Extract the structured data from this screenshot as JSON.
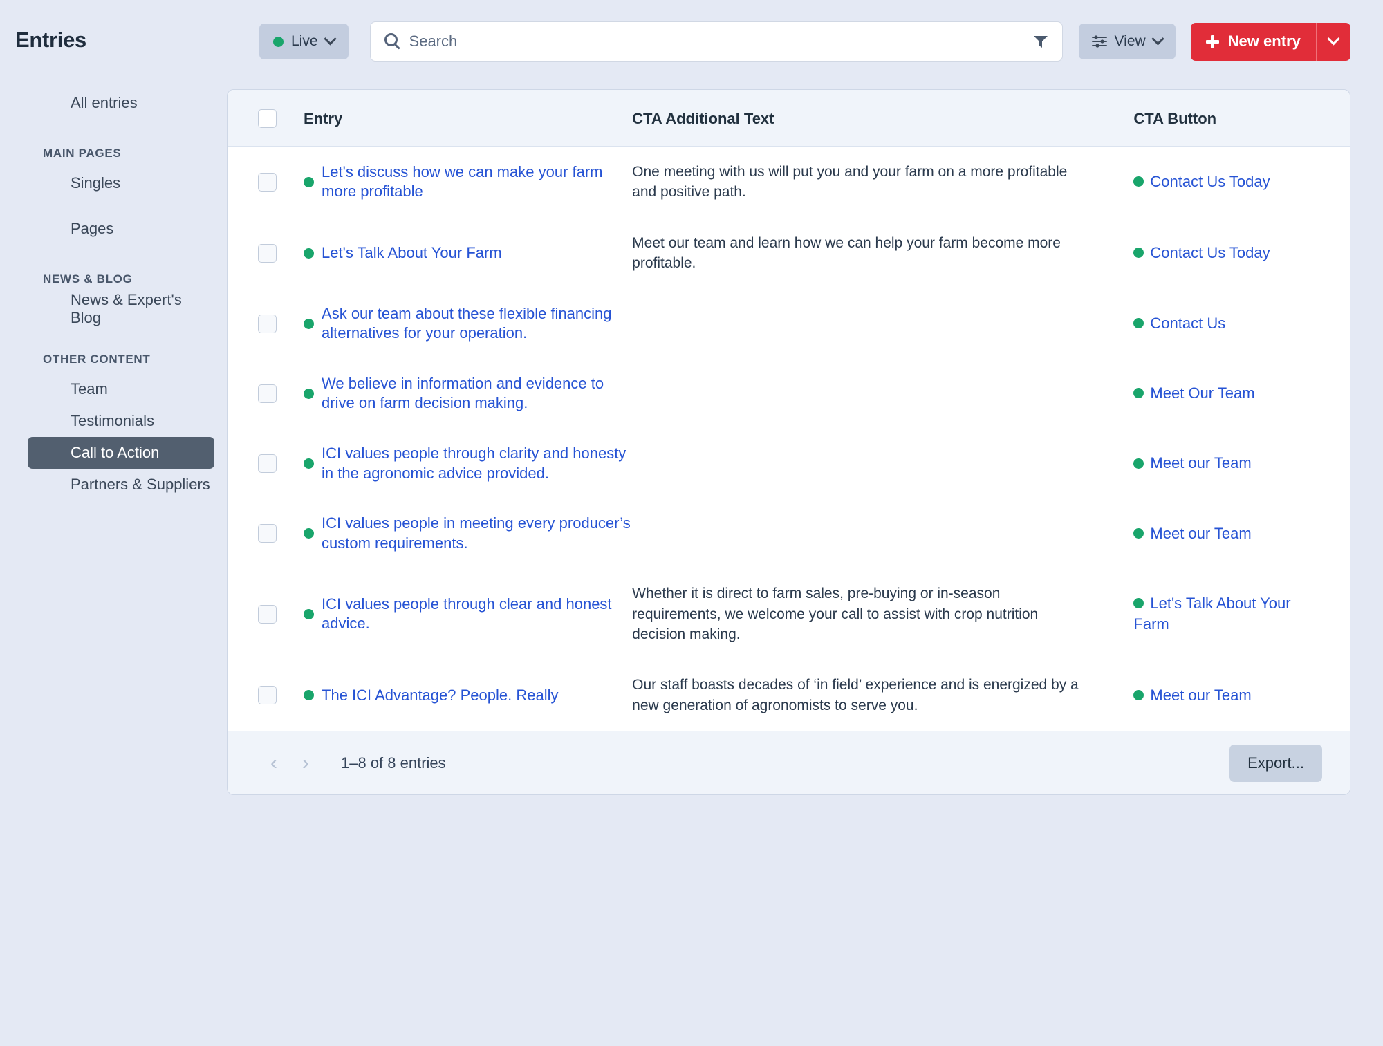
{
  "header": {
    "title": "Entries",
    "status_filter": {
      "label": "Live",
      "dot_color": "#19a56b"
    },
    "search": {
      "value": "",
      "placeholder": "Search"
    },
    "view_button": {
      "label": "View"
    },
    "new_entry_button": {
      "label": "New entry"
    }
  },
  "sidebar": {
    "all_entries": "All entries",
    "groups": [
      {
        "heading": "MAIN PAGES",
        "items": [
          "Singles",
          "Pages"
        ]
      },
      {
        "heading": "NEWS & BLOG",
        "items": [
          "News & Expert's Blog"
        ]
      },
      {
        "heading": "OTHER CONTENT",
        "items": [
          "Team",
          "Testimonials",
          "Call to Action",
          "Partners & Suppliers"
        ]
      }
    ],
    "active_item": "Call to Action"
  },
  "table": {
    "columns": [
      "Entry",
      "CTA Additional Text",
      "CTA Button"
    ],
    "rows": [
      {
        "entry": "Let's discuss how we can make your farm more profitable",
        "cta_text": [
          "One meeting with us will put you and your farm on a more profitable and positive path."
        ],
        "cta_button": "Contact Us Today"
      },
      {
        "entry": "Let's Talk About Your Farm",
        "cta_text": [
          "Meet our team and learn how we can help your farm become more profitable."
        ],
        "cta_button": "Contact Us Today"
      },
      {
        "entry": "Ask our team about these flexible financing alternatives for your operation.",
        "cta_text": [],
        "cta_button": "Contact Us"
      },
      {
        "entry": "We believe in information and evidence to drive on farm decision making.",
        "cta_text": [],
        "cta_button": "Meet Our Team"
      },
      {
        "entry": "ICI values people through clarity and honesty in the agronomic advice provided.",
        "cta_text": [],
        "cta_button": "Meet our Team"
      },
      {
        "entry": "ICI values people in meeting every producer’s custom requirements.",
        "cta_text": [],
        "cta_button": "Meet our Team"
      },
      {
        "entry": "ICI values people through clear and honest advice.",
        "cta_text": [
          "Whether it is direct to farm sales, pre-buying or in-season requirements, we welcome your call to assist with crop nutrition decision making."
        ],
        "cta_button": "Let's Talk About Your Farm"
      },
      {
        "entry": "The ICI Advantage? People. Really",
        "cta_text": [
          "Our staff boasts decades of ‘in field’ experience and is energized by a new generation of agronomists to serve you."
        ],
        "cta_button": "Meet our Team"
      }
    ]
  },
  "footer": {
    "prev": "‹",
    "next": "›",
    "info": "1–8 of 8 entries",
    "export_label": "Export..."
  },
  "colors": {
    "accent_red": "#e12d39",
    "link_blue": "#2653d4",
    "status_green": "#19a56b",
    "page_bg": "#e4e9f4"
  }
}
